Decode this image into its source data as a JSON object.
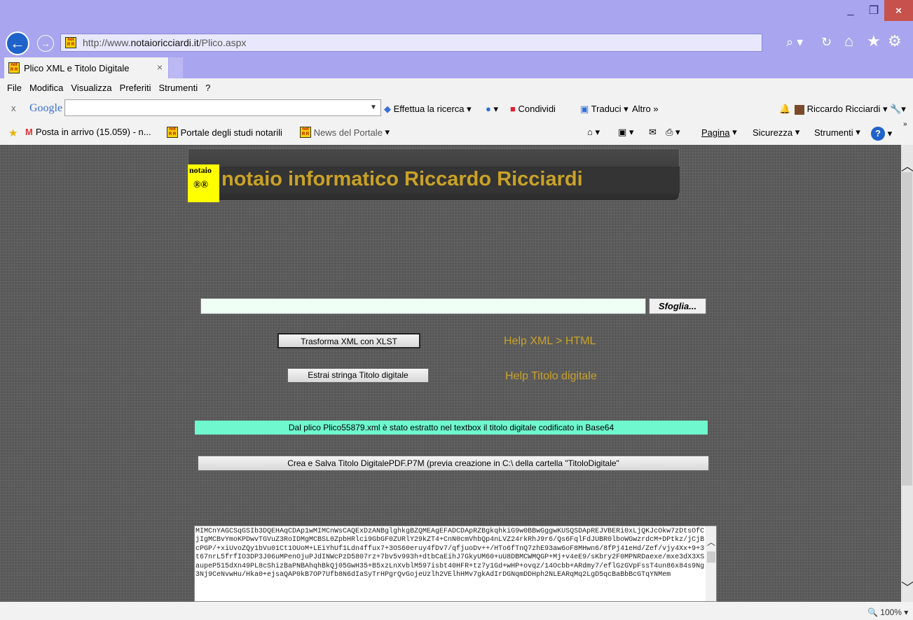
{
  "window": {
    "minimize": "_",
    "maximize": "❐",
    "close": "×"
  },
  "nav": {
    "back": "←",
    "forward": "→",
    "url_prefix": "http://www.",
    "url_domain": "notaioricciardi.it",
    "url_path": "/Plico.aspx",
    "search_icon": "⌕ ▾",
    "refresh_icon": "↻",
    "home_icon": "⌂",
    "star_icon": "★",
    "gear_icon": "⚙"
  },
  "tabs": [
    {
      "label": "Plico XML e Titolo Digitale",
      "close": "×"
    }
  ],
  "menu": [
    "File",
    "Modifica",
    "Visualizza",
    "Preferiti",
    "Strumenti",
    "?"
  ],
  "google_toolbar": {
    "close": "x",
    "logo": "Google",
    "search_label": "Effettua la ricerca",
    "share_label": "Condividi",
    "translate_label": "Traduci",
    "more_label": "Altro »",
    "user_label": "Riccardo Ricciardi"
  },
  "favorites": {
    "gmail": "Posta in arrivo (15.059) - n...",
    "portal": "Portale degli studi notarili",
    "news": "News del Portale",
    "page_menu": "Pagina",
    "security_menu": "Sicurezza",
    "tools_menu": "Strumenti"
  },
  "page": {
    "logo_top": "notaio",
    "logo_bottom": "®®",
    "title": "notaio informatico Riccardo Ricciardi",
    "browse_button": "Sfoglia...",
    "transform_button": "Trasforma XML con XLST",
    "help_xml": "Help XML > HTML",
    "extract_button": "Estrai stringa Titolo digitale",
    "help_titolo": "Help Titolo digitale",
    "status_message": "Dal plico Plico55879.xml è stato estratto nel textbox il titolo digitale codificato in Base64",
    "create_button": "Crea e Salva Titolo DigitalePDF.P7M (previa creazione in C:\\ della cartella \"TitoloDigitale\"",
    "base64_text": "MIMCnYAGCSqGSIb3DQEHAqCDAp1wMIMCnWsCAQExDzANBglghkgBZQMEAgEFADCDApRZBgkqhkiG9w0BBwGggwKUSQSDApREJVBERi0xLjQKJcOkw7zDtsOfCjIgMCBvYmoKPDwvTGVuZ3RoIDMgMCBSL0ZpbHRlci9GbGF0ZURlY29kZT4+CnN0cmVhbQp4nLVZ24rkRhJ9r6/Qs6FqlFdJUBR0lboWGwzrdcM+DPtkz/jCjBcPGP/+xiUvoZQy1bVu01Ct1OUoM+LEiYhUf1Ldn4ffux7+3OS60eruy4fDv7/qfjuoDv++/HTo6fTnQ7zhE93aw6oF8MHwn6/8fPj41eHd/Zef/vjy4Xx+9+3t67nrL5frfIO3DP3J06uMPenOjuPJdINWcPzD5807rz+7bv5v993h+dtbCaEihJ7GkyUM60+uU8DBMCWMQGP+Mj+v4eE9/sKbry2F0MPNRDaexe/mxe3dX3XSaupeP515dXn49PL8cShizBaPNBAhqhBkQj05GwH35+B5xzLnXvblM597isbt40HFR+tz7y1Gd+wHP+ovqz/14Ocbb+ARdmy7/eflGzGVpFssT4un86x84s9Ng3Nj9CeNvwHu/Hka0+ejsaQAP0kB7OP7Ufb8N6dIaSyTrHPgrQvGojeUzlh2VElhHMv7gkAdIrDGNqmDDHph2NLEARqMq2LgD5qcBaBbBcGTqYNMem"
  },
  "statusbar": {
    "zoom": "🔍 100%  ▾"
  }
}
